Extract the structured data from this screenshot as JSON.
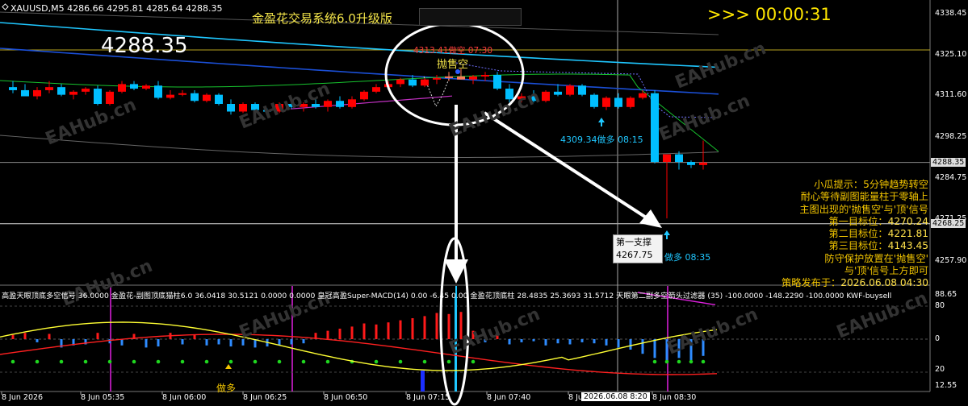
{
  "header": {
    "symbol_info": "XAUUSD,M5  4286.66 4295.81 4285.64 4288.35",
    "big_price": "4288.35",
    "system_title": "金盈花交易系统6.0升级版",
    "timer": ">>> 00:00:31"
  },
  "price_axis": {
    "ticks": [
      "4338.45",
      "4325.10",
      "4311.60",
      "4298.25",
      "4284.75",
      "4271.25",
      "4257.90"
    ],
    "current_price": "4288.35",
    "line_price": "4268.25"
  },
  "indicator_axis": {
    "ticks": [
      "88.65",
      "0",
      "20",
      "12.55"
    ],
    "upper_label": "80"
  },
  "indicator_header": "高盈天眼顶底多空信号 36.0000  金盈花-副图顶底猫柱6.0 36.0418 30.5121 0.0000 0.0000  皇冠高盈Super-MACD(14) 0.00 -6.45 0.00  金盈花顶底柱 28.4835 25.3693 31.5712  天眼第二副多空箭头过滤器 (35) -100.0000 -148.2290 -100.0000  KWF-buysell",
  "time_axis": [
    "8 Jun 2026",
    "8 Jun 05:35",
    "8 Jun 06:00",
    "8 Jun 06:25",
    "8 Jun 06:50",
    "8 Jun 07:15",
    "8 Jun 07:40",
    "8 Jun 08:05",
    "8 Jun 08:30"
  ],
  "time_cursor": "2026.06.08 8:20",
  "annotations": {
    "sell_label": "4313.41做空 07:30",
    "sell_signal": "抛售空",
    "buy_label_1": "4309.34做多 08:15",
    "buy_label_2": "做多 08:35",
    "support_title": "第一支撑",
    "support_value": "4267.75",
    "sub_buy": "做多"
  },
  "tip_panel": {
    "lines": [
      "小瓜提示：5分钟趋势转空",
      "耐心等待副图能量柱于零轴上",
      "主图出现的'抛售空'与'顶'信号"
    ],
    "targets": [
      {
        "label": "第一目标位：",
        "value": "4270.24"
      },
      {
        "label": "第二目标位：",
        "value": "4221.81"
      },
      {
        "label": "第三目标位：",
        "value": "4143.45"
      }
    ],
    "protect_1": "防守保护放置在'抛售空'",
    "protect_2": "与'顶'信号上方即可",
    "release_label": "策略发布于：",
    "release_value": "2026.06.08 04:30"
  },
  "watermark": "EAHub.cn",
  "colors": {
    "bull": "#ff0000",
    "bear": "#00bfff",
    "ma_cyan": "#1fc7ff",
    "ma_blue": "#1b4fd6",
    "highlight": "#ffffff",
    "tip": "#f2c500"
  },
  "candles": [
    {
      "o": 4313,
      "h": 4315,
      "l": 4311,
      "c": 4312
    },
    {
      "o": 4312,
      "h": 4314,
      "l": 4310,
      "c": 4310
    },
    {
      "o": 4310,
      "h": 4313,
      "l": 4309,
      "c": 4312
    },
    {
      "o": 4312,
      "h": 4315,
      "l": 4311,
      "c": 4313
    },
    {
      "o": 4313,
      "h": 4314,
      "l": 4310,
      "c": 4310.5
    },
    {
      "o": 4310.5,
      "h": 4312,
      "l": 4309,
      "c": 4311.5
    },
    {
      "o": 4311.5,
      "h": 4313,
      "l": 4310.5,
      "c": 4312.5
    },
    {
      "o": 4312.5,
      "h": 4313.5,
      "l": 4307,
      "c": 4307.5
    },
    {
      "o": 4307.5,
      "h": 4312,
      "l": 4307,
      "c": 4311.5
    },
    {
      "o": 4311.5,
      "h": 4315,
      "l": 4311,
      "c": 4314
    },
    {
      "o": 4314,
      "h": 4315,
      "l": 4312,
      "c": 4312.5
    },
    {
      "o": 4312.5,
      "h": 4314,
      "l": 4312,
      "c": 4313.5
    },
    {
      "o": 4313.5,
      "h": 4315,
      "l": 4309,
      "c": 4309.5
    },
    {
      "o": 4309.5,
      "h": 4312,
      "l": 4309,
      "c": 4310.5
    },
    {
      "o": 4310.5,
      "h": 4312,
      "l": 4310,
      "c": 4311
    },
    {
      "o": 4311,
      "h": 4312,
      "l": 4308,
      "c": 4308.5
    },
    {
      "o": 4308.5,
      "h": 4311,
      "l": 4308,
      "c": 4310.5
    },
    {
      "o": 4310.5,
      "h": 4311,
      "l": 4307,
      "c": 4307.5
    },
    {
      "o": 4307.5,
      "h": 4309,
      "l": 4304,
      "c": 4305
    },
    {
      "o": 4305,
      "h": 4308,
      "l": 4304.5,
      "c": 4307.5
    },
    {
      "o": 4307.5,
      "h": 4308,
      "l": 4305,
      "c": 4305.5
    },
    {
      "o": 4305.5,
      "h": 4306,
      "l": 4304,
      "c": 4305
    },
    {
      "o": 4305,
      "h": 4308,
      "l": 4304.5,
      "c": 4307.5
    },
    {
      "o": 4307.5,
      "h": 4309,
      "l": 4306,
      "c": 4306.5
    },
    {
      "o": 4306.5,
      "h": 4308,
      "l": 4305,
      "c": 4307.5
    },
    {
      "o": 4307.5,
      "h": 4309,
      "l": 4306,
      "c": 4306.5
    },
    {
      "o": 4306.5,
      "h": 4309,
      "l": 4305,
      "c": 4308.5
    },
    {
      "o": 4308.5,
      "h": 4310,
      "l": 4306,
      "c": 4306.5
    },
    {
      "o": 4306.5,
      "h": 4310,
      "l": 4306,
      "c": 4309
    },
    {
      "o": 4309,
      "h": 4312,
      "l": 4308.5,
      "c": 4311.5
    },
    {
      "o": 4311.5,
      "h": 4314,
      "l": 4311,
      "c": 4313
    },
    {
      "o": 4313,
      "h": 4315,
      "l": 4312,
      "c": 4314
    },
    {
      "o": 4314,
      "h": 4316,
      "l": 4313,
      "c": 4315.5
    },
    {
      "o": 4315.5,
      "h": 4317,
      "l": 4313,
      "c": 4313.5
    },
    {
      "o": 4313.5,
      "h": 4316,
      "l": 4313,
      "c": 4315.5
    },
    {
      "o": 4315.5,
      "h": 4317,
      "l": 4314,
      "c": 4316
    },
    {
      "o": 4316,
      "h": 4318,
      "l": 4315,
      "c": 4316.5
    },
    {
      "o": 4316.5,
      "h": 4319,
      "l": 4315.5,
      "c": 4315.5
    },
    {
      "o": 4315.5,
      "h": 4317,
      "l": 4314,
      "c": 4316.5
    },
    {
      "o": 4316.5,
      "h": 4318,
      "l": 4315,
      "c": 4317
    },
    {
      "o": 4317,
      "h": 4318,
      "l": 4312,
      "c": 4312.5
    },
    {
      "o": 4312.5,
      "h": 4314,
      "l": 4308,
      "c": 4309
    },
    {
      "o": 4309,
      "h": 4311,
      "l": 4308,
      "c": 4310
    },
    {
      "o": 4310,
      "h": 4312,
      "l": 4308,
      "c": 4308.5
    },
    {
      "o": 4308.5,
      "h": 4312,
      "l": 4308,
      "c": 4311.5
    },
    {
      "o": 4311.5,
      "h": 4314,
      "l": 4310,
      "c": 4310.5
    },
    {
      "o": 4310.5,
      "h": 4314,
      "l": 4310,
      "c": 4313.5
    },
    {
      "o": 4313.5,
      "h": 4314,
      "l": 4310,
      "c": 4310.5
    },
    {
      "o": 4310.5,
      "h": 4311,
      "l": 4306,
      "c": 4306.5
    },
    {
      "o": 4306.5,
      "h": 4310,
      "l": 4305.5,
      "c": 4309.5
    },
    {
      "o": 4309.5,
      "h": 4311,
      "l": 4306,
      "c": 4306.5
    },
    {
      "o": 4306.5,
      "h": 4310,
      "l": 4306,
      "c": 4309.5
    },
    {
      "o": 4309.5,
      "h": 4312,
      "l": 4309,
      "c": 4311
    },
    {
      "o": 4311,
      "h": 4312,
      "l": 4288,
      "c": 4288.5
    },
    {
      "o": 4288.5,
      "h": 4291,
      "l": 4270,
      "c": 4291
    },
    {
      "o": 4291,
      "h": 4292,
      "l": 4286,
      "c": 4288.5
    },
    {
      "o": 4288.5,
      "h": 4289,
      "l": 4286.5,
      "c": 4287.5
    },
    {
      "o": 4287.5,
      "h": 4295.5,
      "l": 4286,
      "c": 4288.3
    }
  ],
  "macd_hist": [
    4,
    6,
    -3,
    5,
    -8,
    -6,
    -5,
    6,
    -4,
    -6,
    5,
    -8,
    -7,
    6,
    -5,
    4,
    -6,
    -5,
    -7,
    -6,
    -8,
    -7,
    -6,
    -5,
    -4,
    6,
    8,
    10,
    12,
    15,
    14,
    16,
    18,
    20,
    22,
    25,
    24,
    26,
    8,
    -3,
    4,
    -5,
    -3,
    -2,
    -6,
    -4,
    -5,
    -3,
    -4,
    -6,
    -8,
    -10,
    -14,
    -18,
    -22,
    -18,
    -20,
    -16
  ]
}
